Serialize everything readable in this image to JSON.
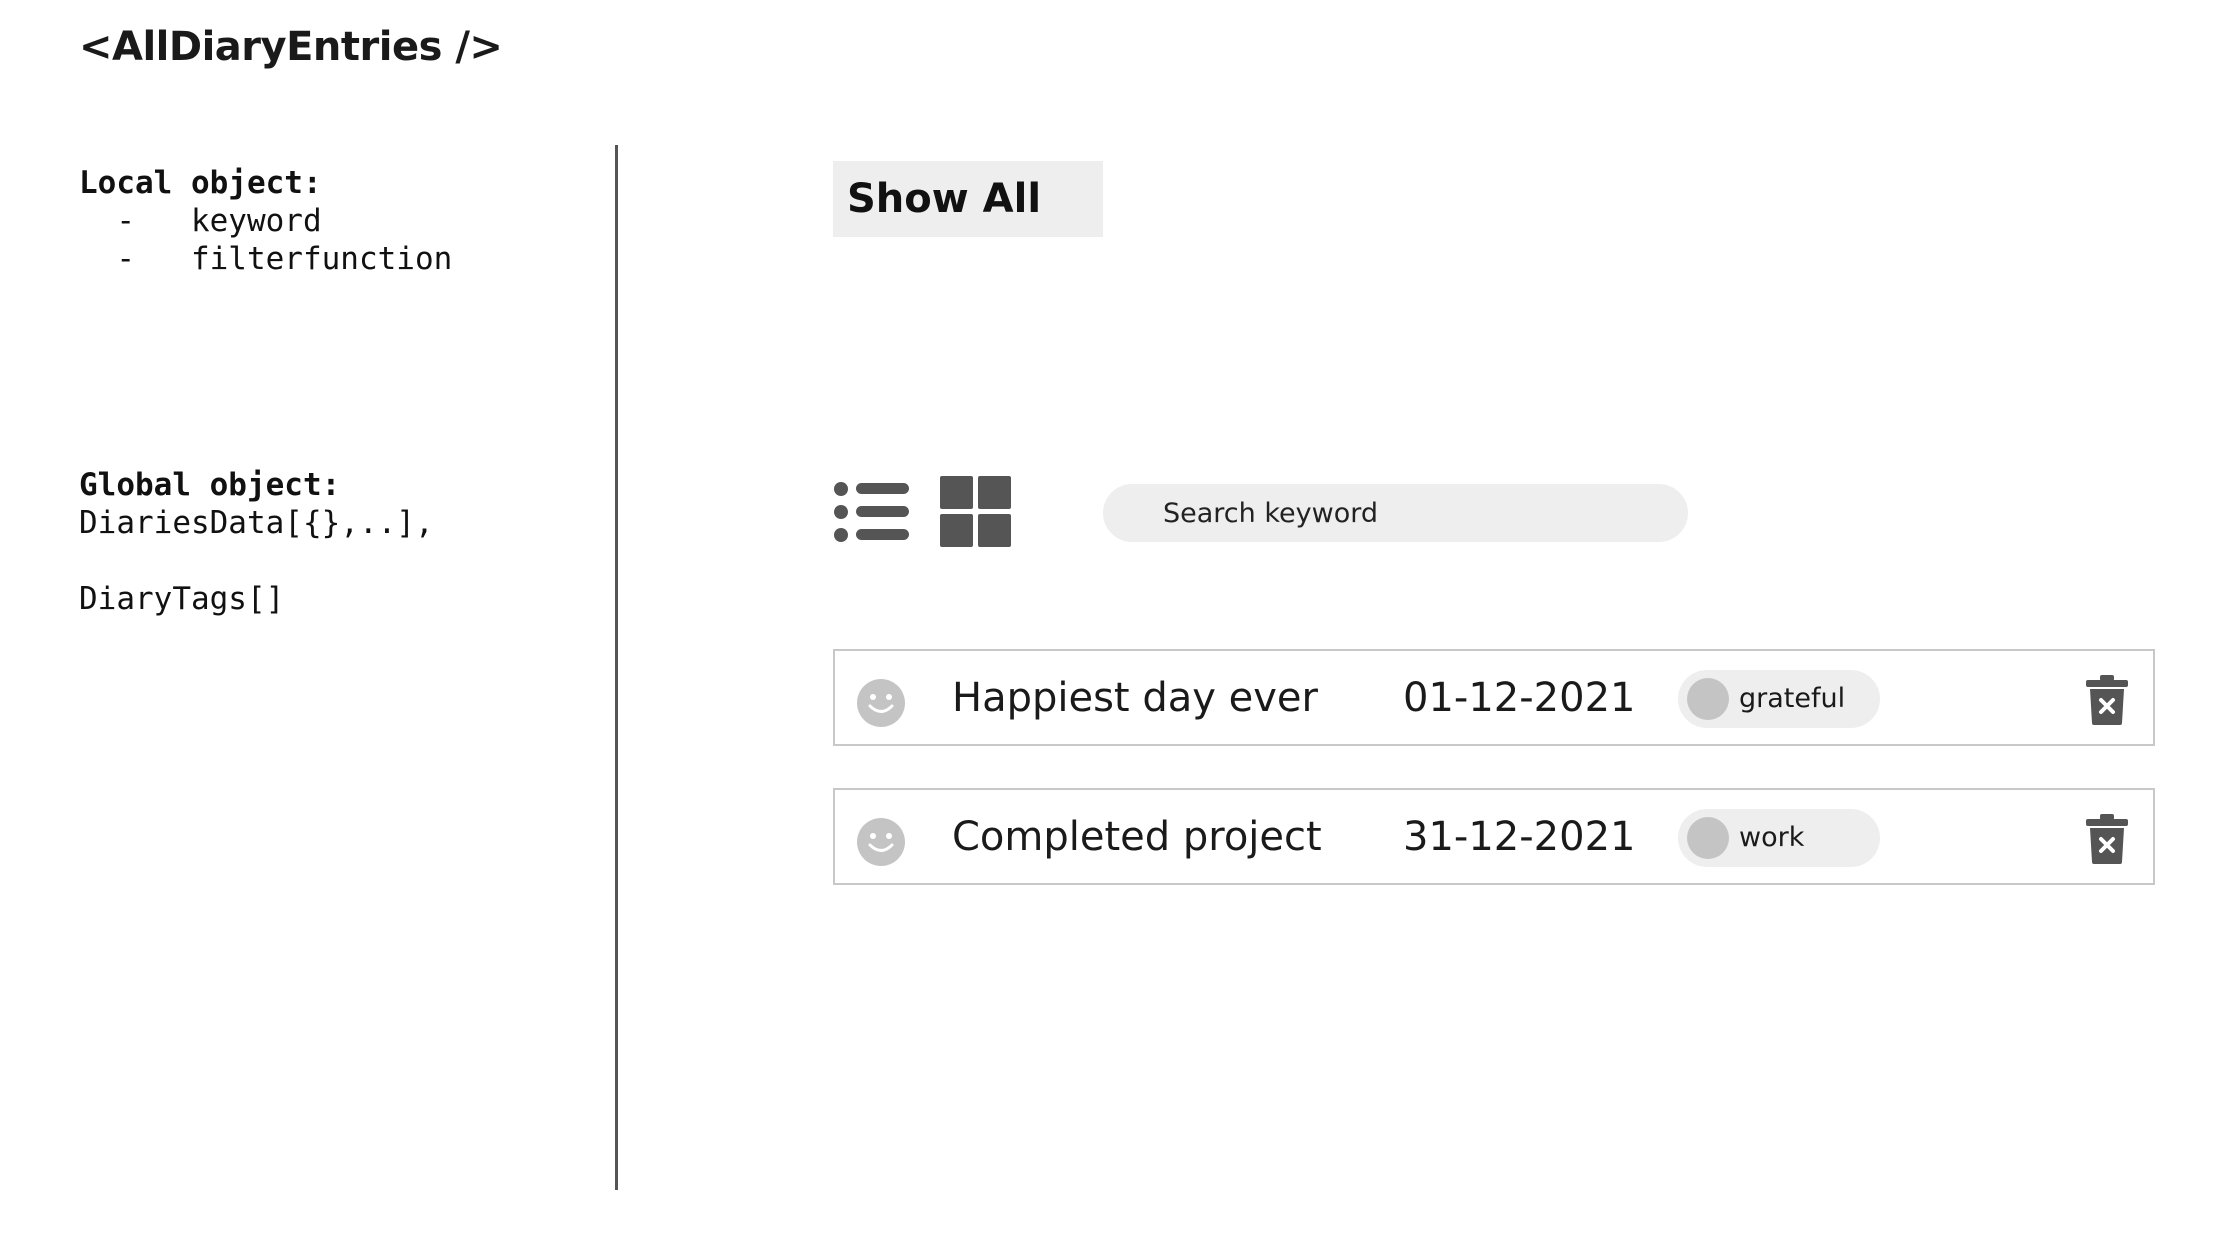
{
  "component_title": "<AllDiaryEntries />",
  "local_object": {
    "heading": "Local object:",
    "items": [
      "keyword",
      "filterfunction"
    ]
  },
  "global_object": {
    "heading": "Global object:",
    "items": [
      "DiariesData[{},..],",
      "DiaryTags[]"
    ]
  },
  "controls": {
    "show_all_label": "Show All",
    "search_placeholder": "Search keyword",
    "list_view_icon": "list-icon",
    "grid_view_icon": "grid-icon"
  },
  "entries": [
    {
      "title": "Happiest day ever",
      "date": "01-12-2021",
      "tag": "grateful",
      "mood_icon": "smiley-face-icon"
    },
    {
      "title": "Completed project",
      "date": "31-12-2021",
      "tag": "work",
      "mood_icon": "smiley-face-icon"
    }
  ],
  "colors": {
    "icon_dark": "#555555",
    "icon_light": "#c4c4c4",
    "field_bg": "#eeeeee",
    "border": "#c8c8c8"
  }
}
